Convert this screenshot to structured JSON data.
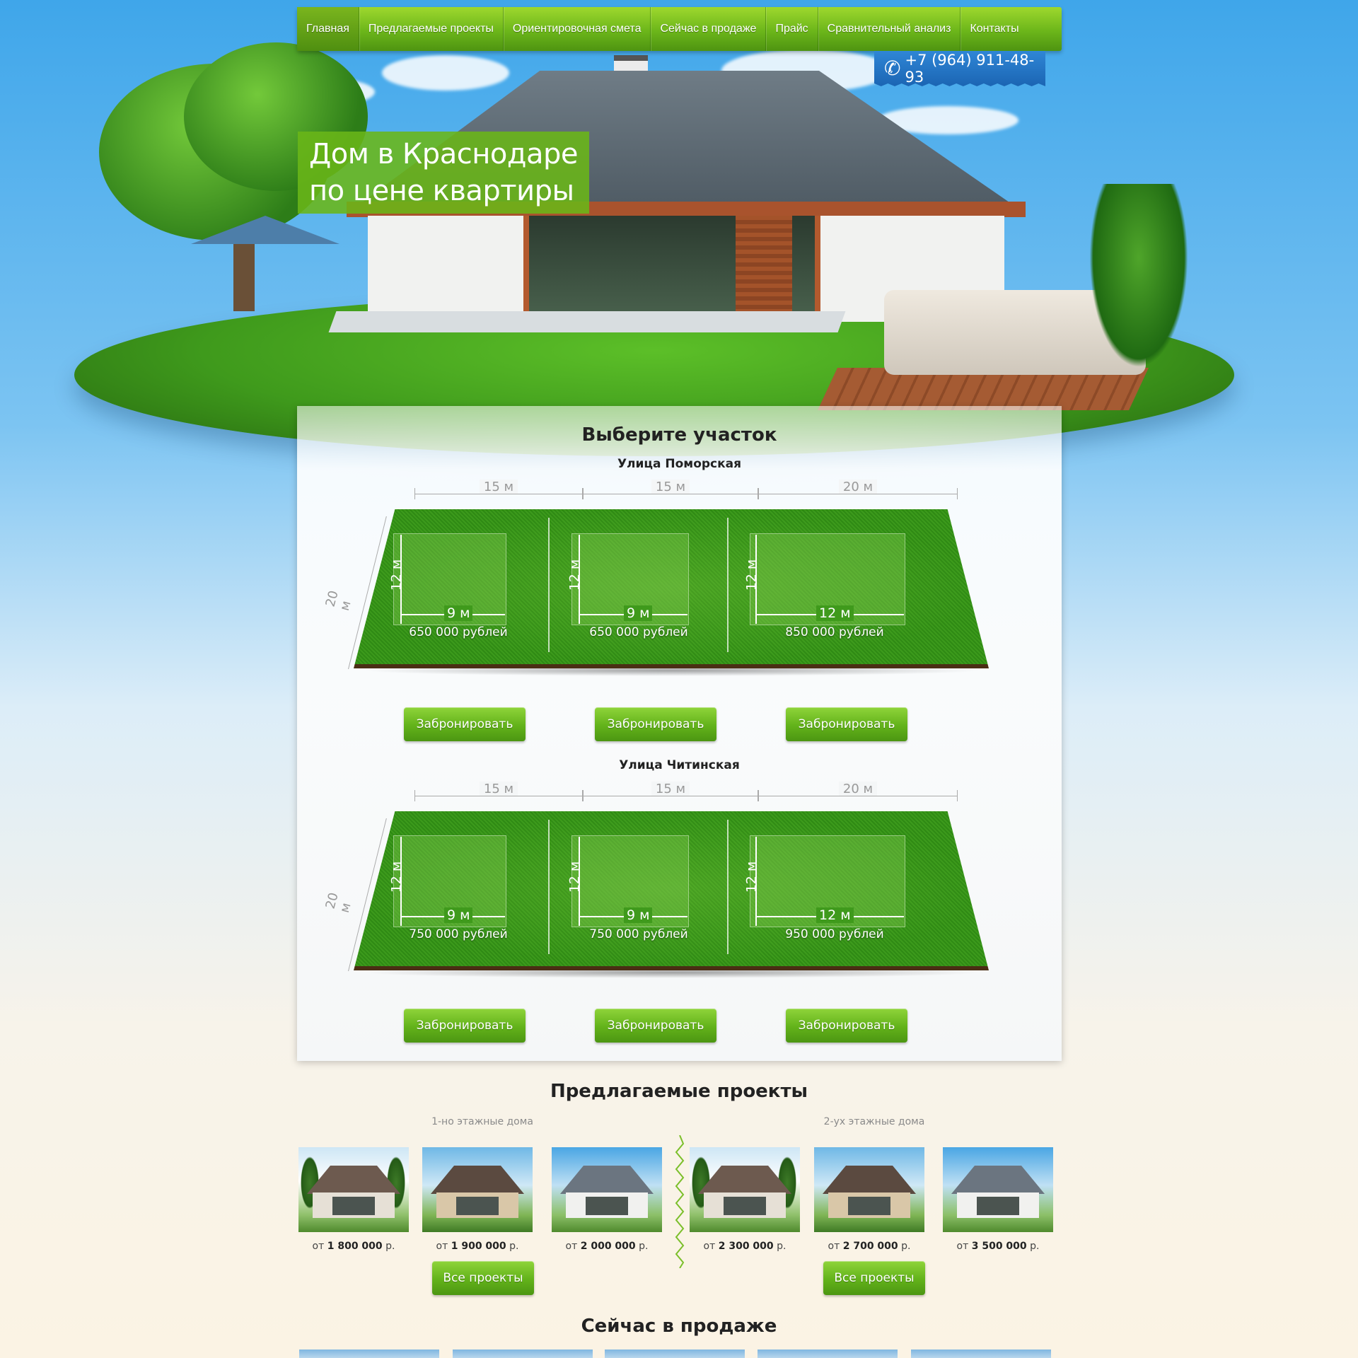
{
  "nav": {
    "items": [
      "Главная",
      "Предлагаемые проекты",
      "Ориентировочная смета",
      "Сейчас в продаже",
      "Прайс",
      "Сравнительный анализ",
      "Контакты"
    ]
  },
  "phone": "+7 (964) 911-48-93",
  "hero": {
    "title_line1": "Дом в Краснодаре",
    "title_line2": "по цене квартиры"
  },
  "plots": {
    "title": "Выберите участок",
    "reserve_label": "Забронировать",
    "depth_label": "20 м",
    "streets": [
      {
        "name": "Улица Поморская",
        "lots": [
          {
            "width": "15 м",
            "house_w": "9 м",
            "house_h": "12 м",
            "price": "650 000 рублей"
          },
          {
            "width": "15 м",
            "house_w": "9 м",
            "house_h": "12 м",
            "price": "650 000 рублей"
          },
          {
            "width": "20 м",
            "house_w": "12 м",
            "house_h": "12 м",
            "price": "850 000 рублей"
          }
        ]
      },
      {
        "name": "Улица Читинская",
        "lots": [
          {
            "width": "15 м",
            "house_w": "9 м",
            "house_h": "12 м",
            "price": "750 000 рублей"
          },
          {
            "width": "15 м",
            "house_w": "9 м",
            "house_h": "12 м",
            "price": "750 000 рублей"
          },
          {
            "width": "20 м",
            "house_w": "12 м",
            "house_h": "12 м",
            "price": "950 000 рублей"
          }
        ]
      }
    ]
  },
  "projects": {
    "title": "Предлагаемые проекты",
    "group1_label": "1-но этажные дома",
    "group2_label": "2-ух этажные дома",
    "all_label": "Все проекты",
    "items": [
      {
        "prefix": "от",
        "price": "1 800 000",
        "suffix": "р."
      },
      {
        "prefix": "от",
        "price": "1 900 000",
        "suffix": "р."
      },
      {
        "prefix": "от",
        "price": "2 000 000",
        "suffix": "р."
      },
      {
        "prefix": "от",
        "price": "2 300 000",
        "suffix": "р."
      },
      {
        "prefix": "от",
        "price": "2 700 000",
        "suffix": "р."
      },
      {
        "prefix": "от",
        "price": "3 500 000",
        "suffix": "р."
      }
    ]
  },
  "sale": {
    "title": "Сейчас в продаже"
  },
  "colors": {
    "accent_green": "#6cb61a",
    "phone_blue": "#1b65b3"
  }
}
